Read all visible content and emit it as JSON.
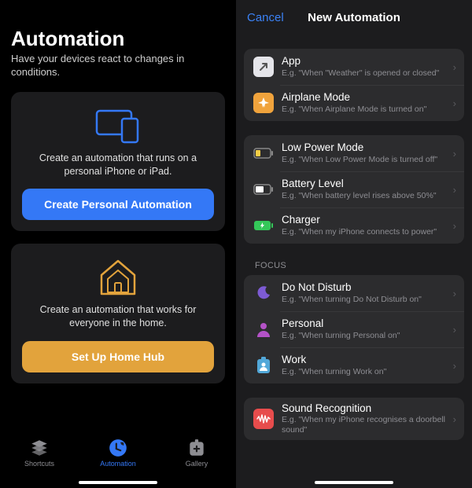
{
  "left": {
    "title": "Automation",
    "subtitle": "Have your devices react to changes in conditions.",
    "personal": {
      "desc": "Create an automation that runs on a personal iPhone or iPad.",
      "button": "Create Personal Automation"
    },
    "home": {
      "desc": "Create an automation that works for everyone in the home.",
      "button": "Set Up Home Hub"
    },
    "tabs": {
      "shortcuts": "Shortcuts",
      "automation": "Automation",
      "gallery": "Gallery"
    }
  },
  "right": {
    "cancel": "Cancel",
    "title": "New Automation",
    "groups": [
      {
        "header": null,
        "rows": [
          {
            "key": "app",
            "title": "App",
            "sub": "E.g. \"When \"Weather\" is opened or closed\""
          },
          {
            "key": "airplane",
            "title": "Airplane Mode",
            "sub": "E.g. \"When Airplane Mode is turned on\""
          }
        ]
      },
      {
        "header": null,
        "rows": [
          {
            "key": "lowpower",
            "title": "Low Power Mode",
            "sub": "E.g. \"When Low Power Mode is turned off\""
          },
          {
            "key": "battery",
            "title": "Battery Level",
            "sub": "E.g. \"When battery level rises above 50%\""
          },
          {
            "key": "charger",
            "title": "Charger",
            "sub": "E.g. \"When my iPhone connects to power\""
          }
        ]
      },
      {
        "header": "FOCUS",
        "rows": [
          {
            "key": "dnd",
            "title": "Do Not Disturb",
            "sub": "E.g. \"When turning Do Not Disturb on\""
          },
          {
            "key": "personal",
            "title": "Personal",
            "sub": "E.g. \"When turning Personal on\""
          },
          {
            "key": "work",
            "title": "Work",
            "sub": "E.g. \"When turning Work on\""
          }
        ]
      },
      {
        "header": null,
        "rows": [
          {
            "key": "sound",
            "title": "Sound Recognition",
            "sub": "E.g. \"When my iPhone recognises a doorbell sound\""
          }
        ]
      }
    ]
  },
  "colors": {
    "blue": "#3478f6",
    "orange": "#e2a33c"
  }
}
